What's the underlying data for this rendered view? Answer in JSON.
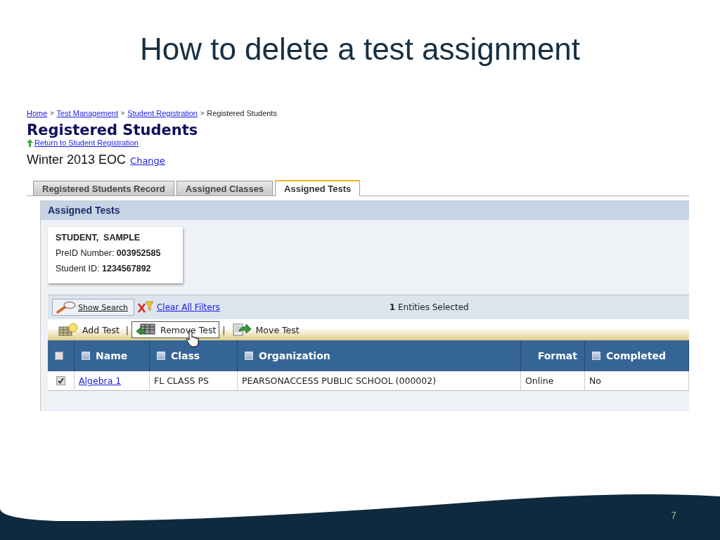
{
  "slide": {
    "title": "How to delete a test assignment",
    "page_number": "7"
  },
  "breadcrumb": [
    {
      "label": "Home",
      "link": true
    },
    {
      "separator": ">",
      "label": "Test Management",
      "link": true
    },
    {
      "separator": ">",
      "label": "Student Registration",
      "link": true
    },
    {
      "separator": ">",
      "label": "Registered Students",
      "link": false
    }
  ],
  "page_title": "Registered Students",
  "return_link": "Return to Student Registration",
  "admin": {
    "name": "Winter 2013 EOC",
    "change_link": "Change"
  },
  "tabs": [
    {
      "label": "Registered Students Record",
      "selected": false
    },
    {
      "label": "Assigned Classes",
      "selected": false
    },
    {
      "label": "Assigned Tests",
      "selected": true
    }
  ],
  "panel": {
    "title": "Assigned Tests"
  },
  "student": {
    "name": "STUDENT,  SAMPLE",
    "fields": [
      {
        "label": "PreID Number:",
        "value": "003952585"
      },
      {
        "label": "Student ID:",
        "value": "1234567892"
      }
    ]
  },
  "toolbar": {
    "show_search": "Show Search",
    "clear_filters": "Clear All Filters",
    "selection_count": "1",
    "selection_text": "Entities Selected"
  },
  "actions": [
    {
      "kind": "add",
      "label": "Add Test",
      "hovered": false
    },
    {
      "kind": "remove",
      "separator": "|",
      "label": "Remove Test",
      "hovered": true
    },
    {
      "kind": "move",
      "separator": "|",
      "label": "Move Test",
      "hovered": false
    }
  ],
  "table": {
    "select_all_checked": false,
    "columns": [
      {
        "label": "Name",
        "filterable": true
      },
      {
        "label": "Class",
        "filterable": true
      },
      {
        "label": "Organization",
        "filterable": true
      },
      {
        "label": "Format",
        "filterable": false
      },
      {
        "label": "Completed",
        "filterable": true
      }
    ],
    "rows": [
      {
        "selected": true,
        "cells": [
          {
            "text": "Algebra 1",
            "link": true
          },
          {
            "text": "FL CLASS PS",
            "link": false
          },
          {
            "text": "PEARSONACCESS PUBLIC SCHOOL (000002)",
            "link": false
          },
          {
            "text": "Online",
            "link": false
          },
          {
            "text": "No",
            "link": false
          }
        ]
      }
    ]
  }
}
